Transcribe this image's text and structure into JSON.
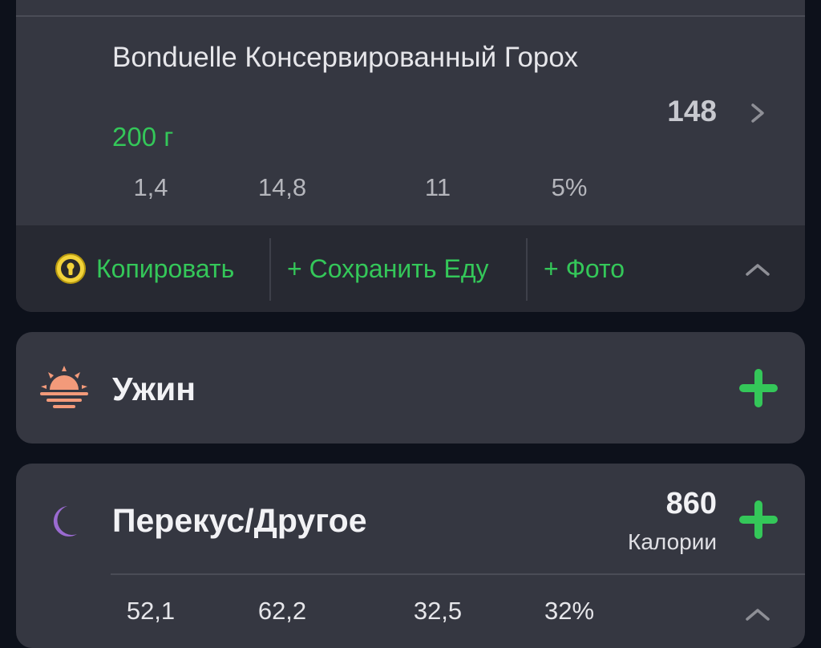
{
  "food_entry": {
    "name": "Bonduelle Консервированный Горох",
    "quantity": "200 г",
    "calories": "148",
    "macros": [
      "1,4",
      "14,8",
      "11",
      "5%"
    ],
    "actions": {
      "copy_label": "Копировать",
      "save_food_label": "+ Сохранить Еду",
      "photo_label": "+ Фото"
    }
  },
  "dinner": {
    "title": "Ужин"
  },
  "snack": {
    "title": "Перекус/Другое",
    "calories": "860",
    "calories_label": "Калории",
    "macros": [
      "52,1",
      "62,2",
      "32,5",
      "32%"
    ]
  },
  "icons": {
    "copy": "coin-icon",
    "dinner": "sunset-icon",
    "snack": "moon-icon",
    "add": "plus-icon"
  },
  "colors": {
    "accent_green": "#34c759",
    "card_background": "#353741",
    "app_background": "#0d111b",
    "sunset": "#f39a7a",
    "moon": "#9b6bd1",
    "coin": "#f2d33a"
  }
}
